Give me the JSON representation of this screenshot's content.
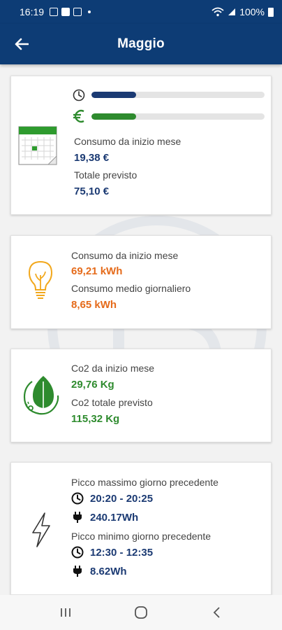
{
  "status_bar": {
    "time": "16:19",
    "battery": "100%"
  },
  "header": {
    "title": "Maggio",
    "back_icon": "arrow-left-icon"
  },
  "colors": {
    "primary": "#0d3c75",
    "cost": "#1b3a73",
    "energy": "#e56b1b",
    "co2": "#2e8b2e"
  },
  "cost_card": {
    "time_progress": 0.26,
    "money_progress": 0.26,
    "consumption_label": "Consumo da inizio mese",
    "consumption_value": "19,38  €",
    "forecast_label": "Totale previsto",
    "forecast_value": "75,10  €"
  },
  "energy_card": {
    "consumption_label": "Consumo da inizio mese",
    "consumption_value": "69,21 kWh",
    "daily_label": "Consumo medio giornaliero",
    "daily_value": "8,65 kWh"
  },
  "co2_card": {
    "co2_label": "Co2 da inizio mese",
    "co2_value": "29,76 Kg",
    "co2_forecast_label": "Co2 totale previsto",
    "co2_forecast_value": "115,32 Kg"
  },
  "peak_card": {
    "max_label": "Picco massimo giorno precedente",
    "max_time": "20:20 - 20:25",
    "max_value": "240.17Wh",
    "min_label": "Picco minimo giorno precedente",
    "min_time": "12:30 - 12:35",
    "min_value": "8.62Wh"
  }
}
